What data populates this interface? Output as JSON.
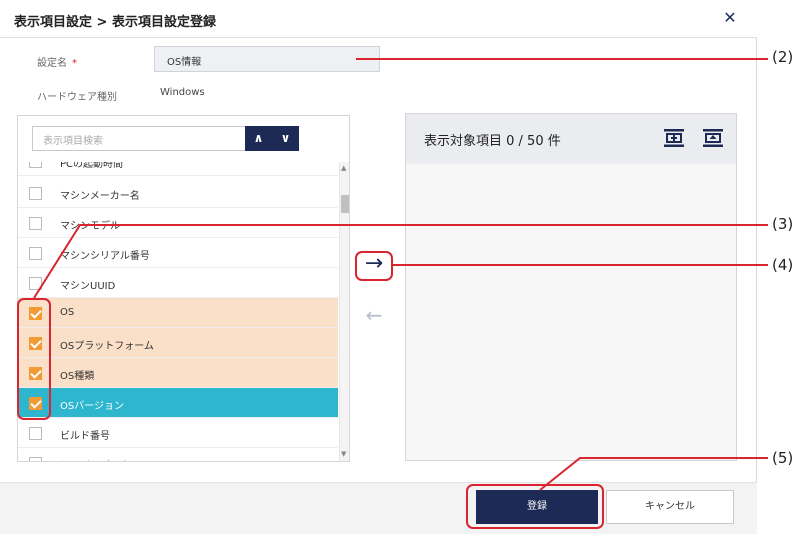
{
  "dialog": {
    "title": "表示項目設定 > 表示項目設定登録",
    "close_glyph": "✕"
  },
  "form": {
    "name_label": "設定名",
    "required_mark": "*",
    "name_value": "OS情報",
    "hw_label": "ハードウェア種別",
    "hw_value": "Windows"
  },
  "left_list": {
    "search_placeholder": "表示項目検索",
    "prev_glyph": "∧",
    "next_glyph": "∨",
    "items": [
      {
        "label": "PCの起動時間",
        "checked": false,
        "state": "normal"
      },
      {
        "label": "マシンメーカー名",
        "checked": false,
        "state": "normal"
      },
      {
        "label": "マシンモデル",
        "checked": false,
        "state": "normal"
      },
      {
        "label": "マシンシリアル番号",
        "checked": false,
        "state": "normal"
      },
      {
        "label": "マシンUUID",
        "checked": false,
        "state": "normal"
      },
      {
        "label": "OS",
        "checked": true,
        "state": "selected"
      },
      {
        "label": "OSプラットフォーム",
        "checked": true,
        "state": "selected"
      },
      {
        "label": "OS種類",
        "checked": true,
        "state": "selected"
      },
      {
        "label": "OSバージョン",
        "checked": true,
        "state": "current"
      },
      {
        "label": "ビルド番号",
        "checked": false,
        "state": "normal"
      },
      {
        "label": "サービスパック",
        "checked": false,
        "state": "normal"
      }
    ]
  },
  "move": {
    "add_glyph": "→",
    "remove_glyph": "←"
  },
  "right_panel": {
    "header": "表示対象項目 0 / 50 件"
  },
  "footer": {
    "register_label": "登録",
    "cancel_label": "キャンセル"
  },
  "callouts": [
    "(2)",
    "(3)",
    "(4)",
    "(5)"
  ],
  "colors": {
    "navy": "#1c2a55",
    "selected_row": "#fbe0c9",
    "current_row": "#2eb6cf",
    "checkbox": "#f29a33",
    "callout_red": "#d9252f"
  }
}
